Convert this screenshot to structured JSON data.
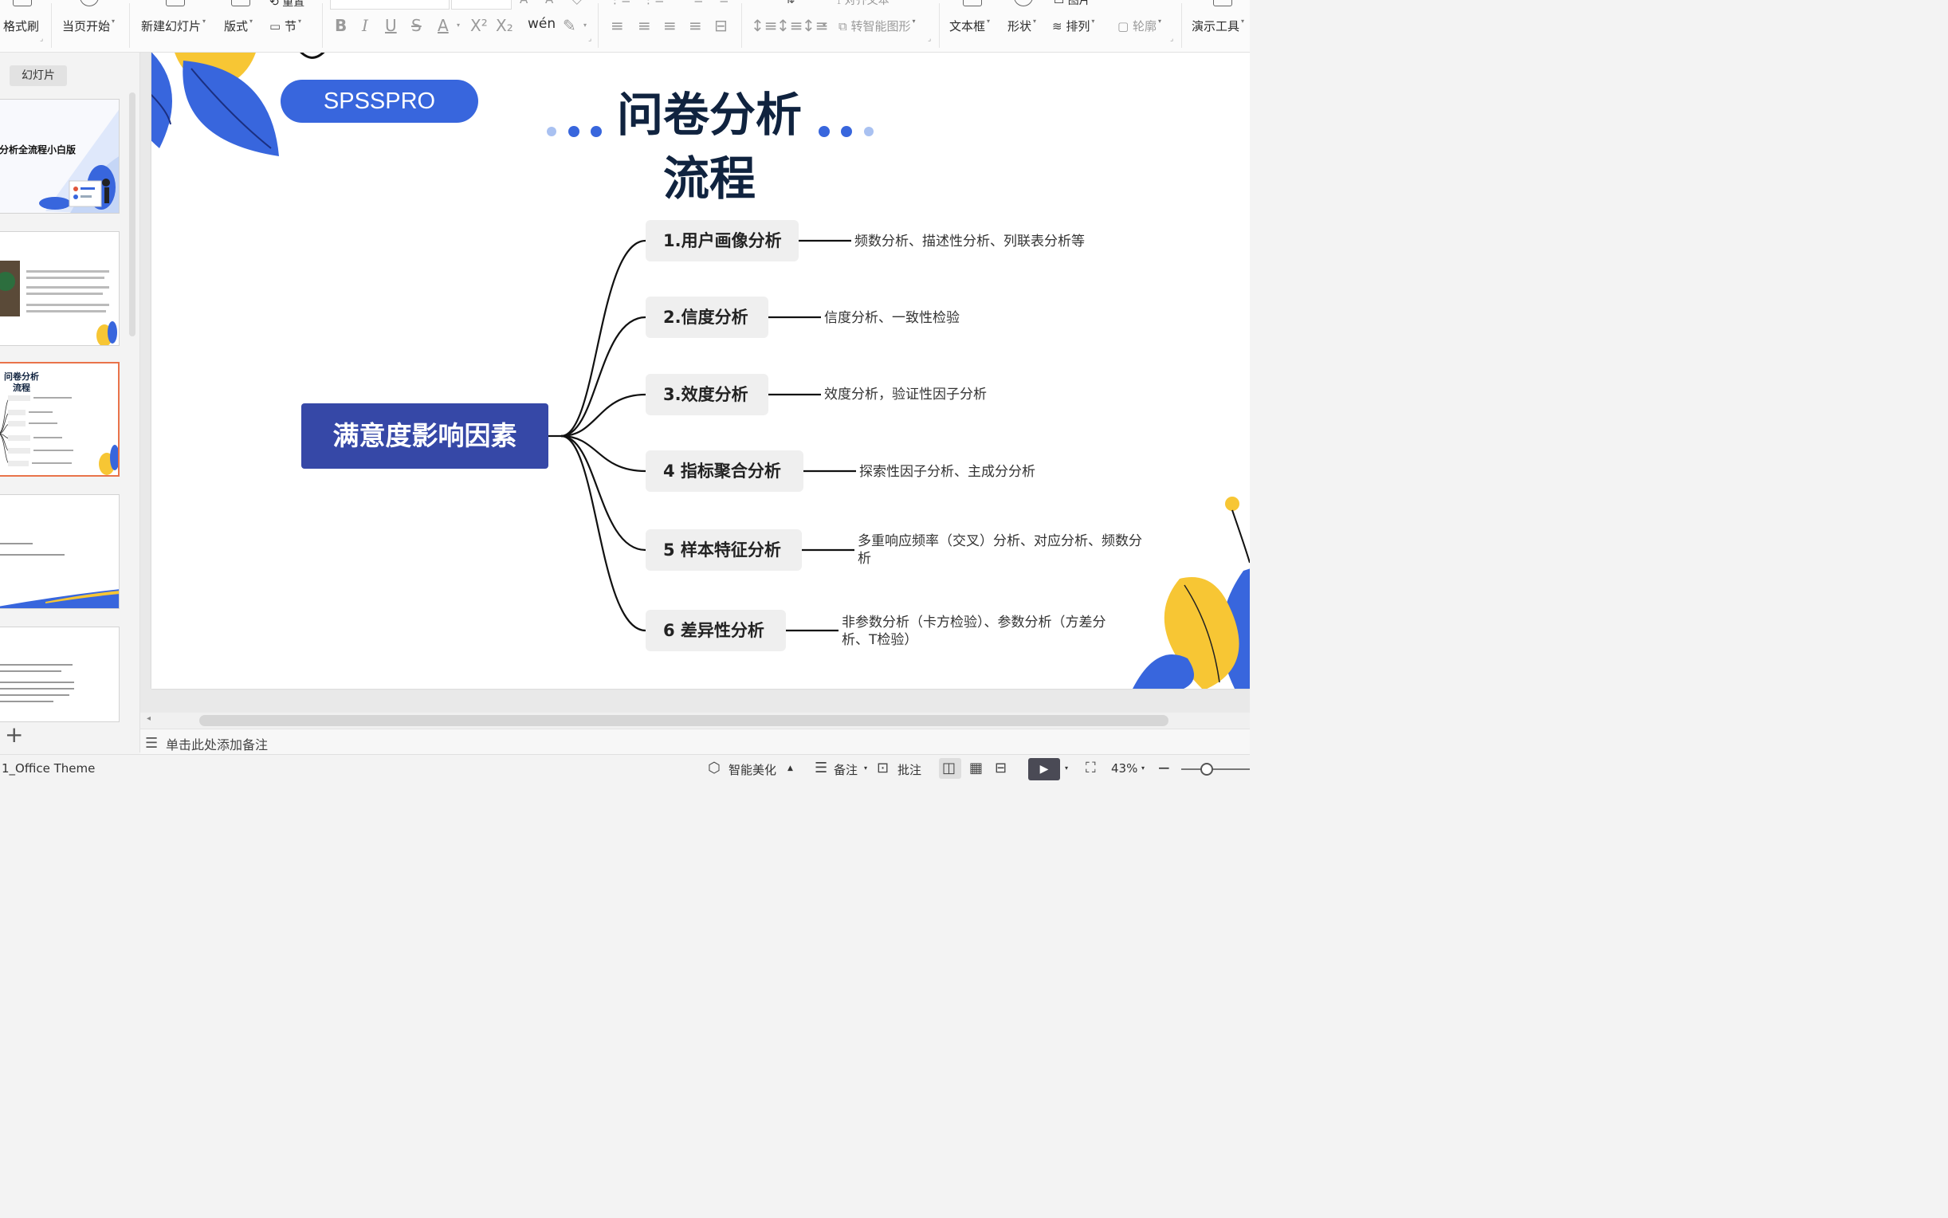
{
  "toolbar": {
    "format_painter": "格式刷",
    "from_current": "当页开始",
    "new_slide": "新建幻灯片",
    "layout": "版式",
    "section": "节",
    "convert_smart": "转智能图形",
    "text_box": "文本框",
    "shape": "形状",
    "arrange": "排列",
    "outline": "轮廓",
    "presentation_tools": "演示工具",
    "reset": "重置",
    "align_text": "对齐文本",
    "picture": "图片"
  },
  "left_panel": {
    "tab_label": "幻灯片",
    "thumb1_title": "分析全流程小白版",
    "thumb3_title": "问卷分析流程"
  },
  "slide": {
    "pill_text": "SPSSPRO",
    "title_line1": "问卷分析",
    "title_line2": "流程",
    "root": "满意度影响因素",
    "nodes": [
      {
        "label": "1.用户画像分析",
        "desc": "频数分析、描述性分析、列联表分析等"
      },
      {
        "label": "2.信度分析",
        "desc": "信度分析、一致性检验"
      },
      {
        "label": "3.效度分析",
        "desc": "效度分析，验证性因子分析"
      },
      {
        "label": "4 指标聚合分析",
        "desc": "探索性因子分析、主成分分析"
      },
      {
        "label": "5 样本特征分析",
        "desc": "多重响应频率（交叉）分析、对应分析、频数分析"
      },
      {
        "label": "6 差异性分析",
        "desc": "非参数分析（卡方检验）、参数分析（方差分析、T检验）"
      }
    ]
  },
  "notes": {
    "placeholder": "单击此处添加备注"
  },
  "status_bar": {
    "theme": "1_Office Theme",
    "smart_beautify": "智能美化",
    "notes": "备注",
    "comments": "批注",
    "zoom": "43%"
  },
  "colors": {
    "pill_blue": "#3866dd",
    "root_blue": "#3648a7",
    "title_navy": "#10233f",
    "dot_blue": "#3866dd",
    "dot_light": "#a9c1f1",
    "leaf_yellow": "#f7c634",
    "active_thumb_border": "#e9734a"
  }
}
